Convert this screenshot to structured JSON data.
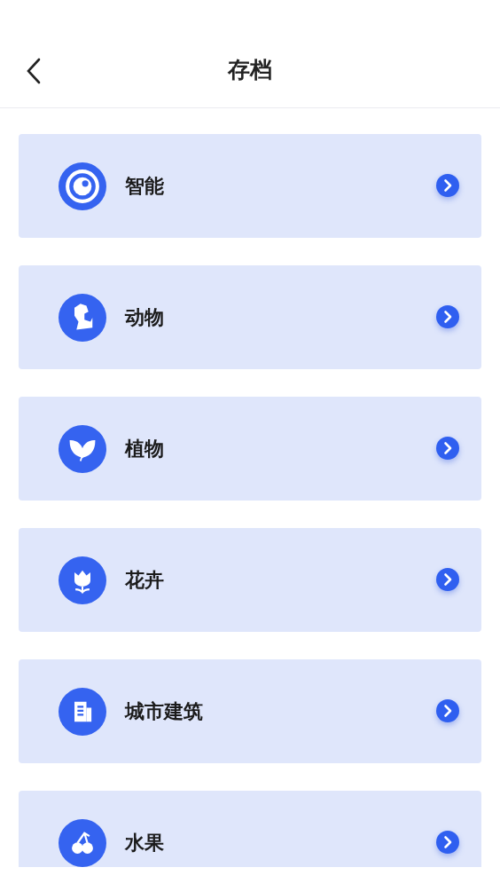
{
  "header": {
    "title": "存档"
  },
  "categories": [
    {
      "label": "智能"
    },
    {
      "label": "动物"
    },
    {
      "label": "植物"
    },
    {
      "label": "花卉"
    },
    {
      "label": "城市建筑"
    },
    {
      "label": "水果"
    }
  ]
}
